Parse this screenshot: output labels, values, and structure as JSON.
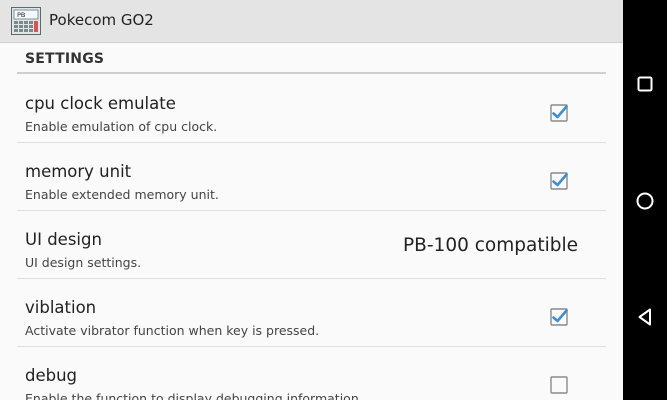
{
  "app": {
    "title": "Pokecom GO2",
    "icon": "pocket-computer-app-icon"
  },
  "settings": {
    "header": "SETTINGS",
    "items": [
      {
        "title": "cpu clock emulate",
        "summary": "Enable emulation of cpu clock.",
        "checked": true
      },
      {
        "title": "memory unit",
        "summary": "Enable extended memory unit.",
        "checked": true
      },
      {
        "title": "UI design",
        "summary": "UI design settings.",
        "value": "PB-100 compatible"
      },
      {
        "title": "viblation",
        "summary": "Activate vibrator function when key is pressed.",
        "checked": true
      },
      {
        "title": "debug",
        "summary": "Enable the function to display debugging information.",
        "checked": false
      }
    ]
  },
  "navbar": {
    "icons": [
      "recents-square-icon",
      "home-circle-icon",
      "back-triangle-icon"
    ]
  },
  "colors": {
    "accent": "#3d8fd4",
    "titlebar": "#e4e4e4",
    "background": "#fafafa",
    "navbar": "#000000"
  }
}
